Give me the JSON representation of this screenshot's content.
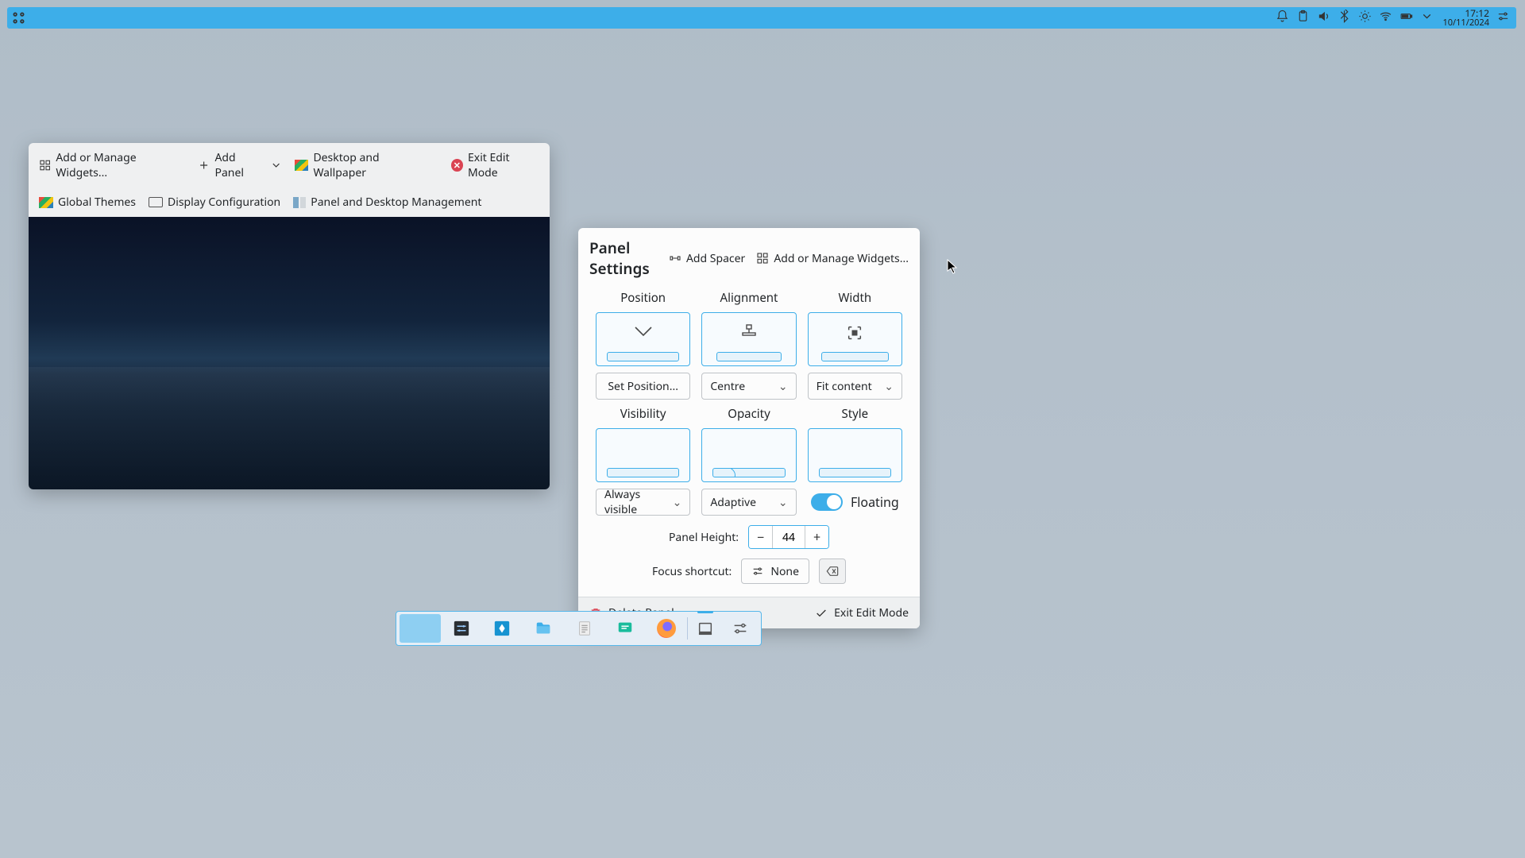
{
  "top_panel": {
    "time": "17:12",
    "date": "10/11/2024",
    "tray_icons": [
      "notifications",
      "clipboard",
      "volume",
      "bluetooth",
      "brightness",
      "network",
      "battery",
      "chevron",
      "clock",
      "sliders"
    ]
  },
  "edit_window": {
    "widgets_btn": "Add or Manage Widgets...",
    "add_panel_btn": "Add Panel",
    "desktop_wallpaper_btn": "Desktop and Wallpaper",
    "exit_btn": "Exit Edit Mode",
    "global_themes_btn": "Global Themes",
    "display_config_btn": "Display Configuration",
    "panel_desktop_mgmt_btn": "Panel and Desktop Management"
  },
  "panel_settings": {
    "title": "Panel Settings",
    "add_spacer": "Add Spacer",
    "add_widgets": "Add or Manage Widgets...",
    "position": {
      "label": "Position",
      "button": "Set Position..."
    },
    "alignment": {
      "label": "Alignment",
      "value": "Centre"
    },
    "width": {
      "label": "Width",
      "value": "Fit content"
    },
    "visibility": {
      "label": "Visibility",
      "value": "Always visible"
    },
    "opacity": {
      "label": "Opacity",
      "value": "Adaptive"
    },
    "style": {
      "label": "Style",
      "toggle_label": "Floating",
      "toggle_on": true
    },
    "panel_height": {
      "label": "Panel Height:",
      "value": "44"
    },
    "focus_shortcut": {
      "label": "Focus shortcut:",
      "value": "None"
    },
    "footer": {
      "delete": "Delete Panel",
      "exit": "Exit Edit Mode"
    }
  },
  "dock": {
    "items": [
      "show-desktop",
      "system-settings",
      "app-launcher",
      "file-manager",
      "text-editor",
      "chat",
      "firefox"
    ],
    "right_items": [
      "panel-icon",
      "settings-sliders"
    ]
  }
}
